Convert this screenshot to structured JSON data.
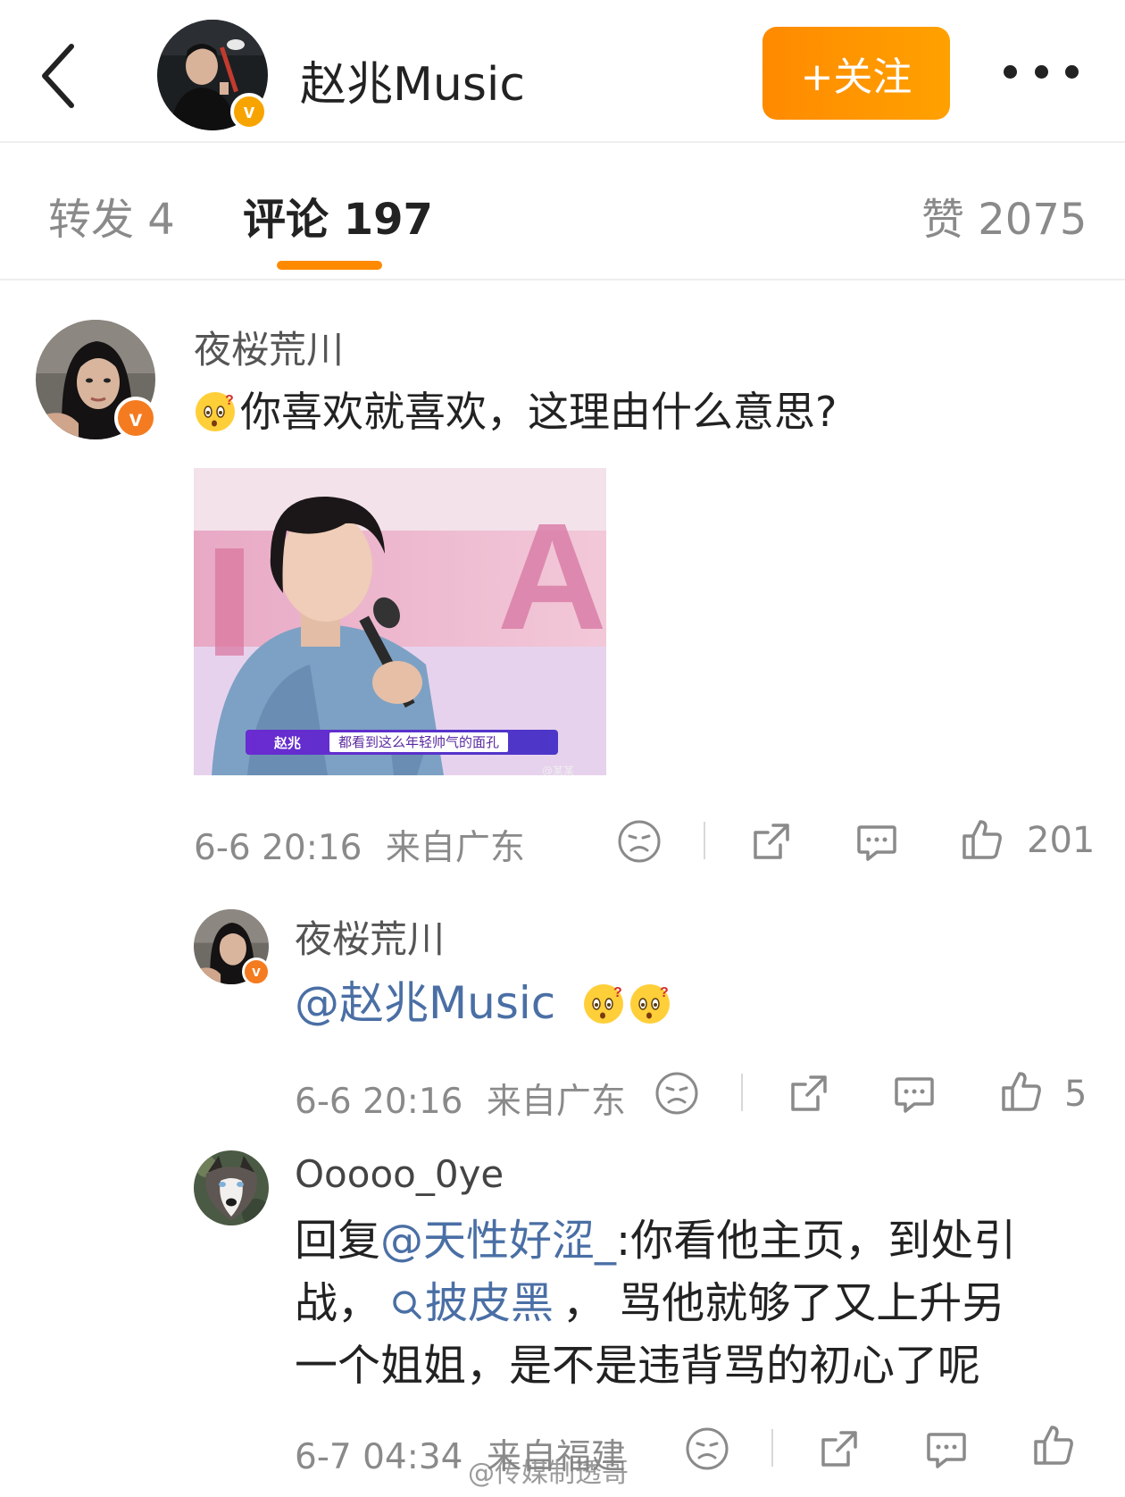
{
  "header": {
    "account_name": "赵兆Music",
    "follow_label": "+关注"
  },
  "tabs": [
    {
      "label": "转发 4"
    },
    {
      "label": "评论 197"
    },
    {
      "label": "赞 2075"
    }
  ],
  "comments": [
    {
      "username": "夜桜荒川",
      "text": "你喜欢就喜欢，这理由什么意思?",
      "image": {
        "caption_name": "赵兆",
        "caption_line": "都看到这么年轻帅气的面孔",
        "watermark": "@某某"
      },
      "time": "6-6 20:16",
      "location": "来自广东",
      "likes": "201"
    },
    {
      "username": "夜桜荒川",
      "mention": "@赵兆Music",
      "time": "6-6 20:16",
      "location": "来自广东",
      "likes": "5"
    },
    {
      "username": "Ooooo_0ye",
      "reply_prefix": "回复",
      "mention": "@天性好涩_",
      "text_line1": ":你看他主页，到处引",
      "text_line2a": "战，",
      "topic": "披皮黑",
      "text_line2b": "， 骂他就够了又上升另",
      "text_line3": "一个姐姐，是不是违背骂的初心了呢",
      "time": "6-7 04:34",
      "location": "来自福建"
    }
  ],
  "watermark": "@传媒制透哥",
  "colors": {
    "accent_orange": "#ff8a00",
    "mention_blue": "#4a6fa5",
    "verified_badge": "#f7a400"
  },
  "icons": [
    "back-icon",
    "more-icon",
    "verified-badge-icon",
    "dislike-icon",
    "share-icon",
    "comment-icon",
    "like-icon",
    "search-icon",
    "confused-emoji-icon"
  ]
}
